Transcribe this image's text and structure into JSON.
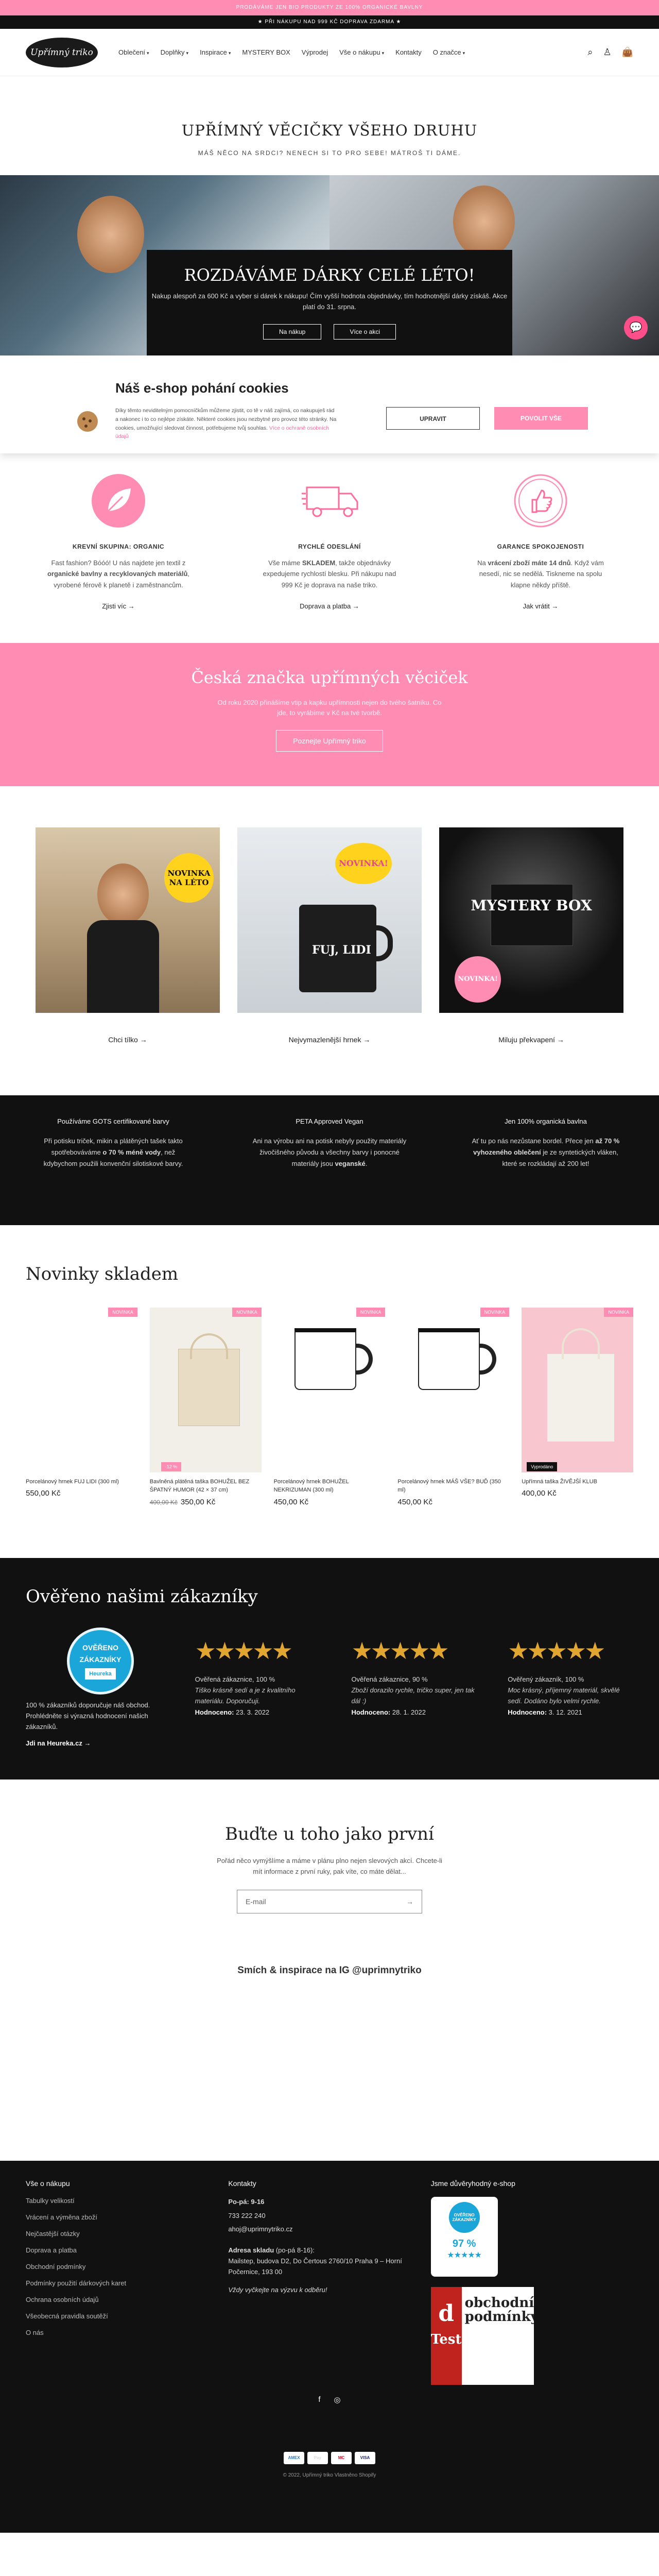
{
  "announcement": {
    "pink": "PRODÁVÁME JEN BIO PRODUKTY ZE 100% ORGANICKÉ BAVLNY",
    "black": "★ PŘI NÁKUPU NAD 999 KČ DOPRAVA ZDARMA ★"
  },
  "header": {
    "logo": "Upřímný triko",
    "nav": [
      "Oblečení",
      "Doplňky",
      "Inspirace",
      "MYSTERY BOX",
      "Výprodej",
      "Vše o nákupu",
      "Kontakty",
      "O značce"
    ],
    "nav_dropdown": [
      true,
      true,
      true,
      false,
      false,
      true,
      false,
      true
    ]
  },
  "hero": {
    "title": "UPŘÍMNÝ VĚCIČKY VŠEHO DRUHU",
    "subtitle": "MÁŠ NĚCO NA SRDCI? NENECH SI TO PRO SEBE! MÁTROŠ TI DÁME.",
    "banner_title": "ROZDÁVÁME DÁRKY CELÉ LÉTO!",
    "banner_text": "Nakup alespoň za 600 Kč a vyber si dárek k nákupu! Čím vyšší hodnota objednávky, tím hodnotnější dárky získáš. Akce platí do 31. srpna.",
    "btn1": "Na nákup",
    "btn2": "Více o akci"
  },
  "cookies": {
    "title": "Náš e-shop pohání cookies",
    "text": "Díky těmto neviditelným pomocníčkům můžeme zjistit, co tě v náš zajímá, co nakupuješ rád a nakonec i to co nejlépe získáte. Některé cookies jsou nezbytné pro provoz této stránky. Na cookies, umožňující sledovat činnost, potřebujeme tvůj souhlas.",
    "link": "Více o ochraně osobních údajů",
    "btn_adjust": "UPRAVIT",
    "btn_allow": "POVOLIT VŠE"
  },
  "features": [
    {
      "title": "KREVNÍ SKUPINA: ORGANIC",
      "text_a": "Fast fashion? Bóóó! U nás najdete jen textil z ",
      "bold": "organické bavlny a recyklovaných materiálů",
      "text_b": ", vyrobené férově k planetě i zaměstnancům.",
      "link": "Zjisti víc"
    },
    {
      "title": "RYCHLÉ ODESLÁNÍ",
      "text_a": "Vše máme ",
      "bold": "SKLADEM",
      "text_b": ", takže objednávky expedujeme rychlostí blesku. Při nákupu nad 999 Kč je doprava na naše triko.",
      "link": "Doprava a platba"
    },
    {
      "title": "GARANCE SPOKOJENOSTI",
      "text_a": "Na ",
      "bold": "vrácení zboží máte 14 dnů",
      "text_b": ". Když vám nesedí, nic se nedělá. Tiskneme na spolu klapne někdy příště.",
      "link": "Jak vrátit"
    }
  ],
  "pink_band": {
    "title": "Česká značka upřímných věciček",
    "text": "Od roku 2020 přinášíme vtip a kapku upřímnosti nejen do tvého šatníku. Co jde, to vyrábíme v Kč na tvé tvorbě.",
    "button": "Poznejte Upřímný triko"
  },
  "collections": [
    {
      "label": "Chci tílko",
      "badge": "NOVINKA NA LÉTO"
    },
    {
      "label": "Nejvymazlenější hrnek",
      "badge": "NOVINKA!"
    },
    {
      "label": "Miluju překvapení",
      "badge": "NOVINKA!",
      "mystery": "MYSTERY BOX"
    }
  ],
  "info_strip": [
    {
      "title": "Používáme GOTS certifikované barvy",
      "text_a": "Při potisku triček, mikin a plátěných tašek takto spotřebováváme ",
      "bold": "o 70 % méně vody",
      "text_b": ", než kdybychom použili konvenční silotiskové barvy."
    },
    {
      "title": "PETA Approved Vegan",
      "text_a": "Ani na výrobu ani na potisk nebyly použity materiály živočišného původu a všechny barvy i ponocné materiály jsou ",
      "bold": "veganské",
      "text_b": "."
    },
    {
      "title": "Jen 100% organická bavlna",
      "text_a": "Ať tu po nás nezůstane bordel. Přece jen ",
      "bold": "až 70 % vyhozeného oblečení",
      "text_b": " je ze syntetických vláken, které se rozkládají až 200 let!"
    }
  ],
  "new_products": {
    "title": "Novinky skladem",
    "items": [
      {
        "name": "Porcelánový hrnek FUJ LIDI (300 ml)",
        "price": "550,00 Kč",
        "sale": "NOVINKA",
        "old": ""
      },
      {
        "name": "Bavlněná plátěná taška BOHUŽEL BEZ ŠPATNÝ HUMOR (42 × 37 cm)",
        "price": "350,00 Kč",
        "sale": "NOVINKA",
        "old": "400,00 Kč",
        "discount": "-12 %"
      },
      {
        "name": "Porcelánový hrnek BOHUŽEL NEKRIZUMAN (300 ml)",
        "price": "450,00 Kč",
        "sale": "NOVINKA",
        "old": ""
      },
      {
        "name": "Porcelánový hrnek MÁŠ VŠE? BUĎ (350 ml)",
        "price": "450,00 Kč",
        "sale": "NOVINKA",
        "old": ""
      },
      {
        "name": "Upřímná taška ŽIVĚJŠÍ KLUB",
        "price": "400,00 Kč",
        "sale": "NOVINKA",
        "old": "",
        "soldout": "Vyprodáno"
      }
    ]
  },
  "reviews": {
    "title": "Ověřeno našimi zákazníky",
    "heureka_badge": "OVĚŘENO ZÁKAZNÍKY",
    "heureka_brand": "Heureka",
    "heureka_text": "100 % zákazníků doporučuje náš obchod. Prohlédněte si výrazná hodnocení našich zákazníků.",
    "heureka_link": "Jdi na Heureka.cz",
    "items": [
      {
        "head": "Ověřená zákaznice, 100 %",
        "quote": "Tiško krásně sedí a je z kvalitního materiálu. Doporučuji.",
        "date_label": "Hodnoceno:",
        "date": "23. 3. 2022"
      },
      {
        "head": "Ověřená zákaznice, 90 %",
        "quote": "Zboží dorazilo rychle, tričko super, jen tak dál :)",
        "date_label": "Hodnoceno:",
        "date": "28. 1. 2022"
      },
      {
        "head": "Ověřený zákazník, 100 %",
        "quote": "Moc krásný, příjemný materiál, skvělé sedí. Dodáno bylo velmi rychle.",
        "date_label": "Hodnoceno:",
        "date": "3. 12. 2021"
      }
    ]
  },
  "newsletter": {
    "title": "Buďte u toho jako první",
    "text": "Pořád něco vymýšlíme a máme v plánu plno nejen slevových akcí. Chcete-li mít informace z první ruky, pak víte, co máte dělat...",
    "placeholder": "E-mail"
  },
  "instagram": {
    "title": "Smích & inspirace na IG @uprimnytriko"
  },
  "footer": {
    "col1_title": "Vše o nákupu",
    "col1_links": [
      "Tabulky velikostí",
      "Vrácení a výměna zboží",
      "Nejčastější otázky",
      "Doprava a platba",
      "Obchodní podmínky",
      "Podmínky použití dárkových karet",
      "Ochrana osobních údajů",
      "Všeobecná pravidla soutěží",
      "O nás"
    ],
    "col2_title": "Kontakty",
    "hours": "Po-pá: 9-16",
    "phone": "733 222 240",
    "email": "ahoj@uprimnytriko.cz",
    "addr_label": "Adresa skladu",
    "addr_hours": " (po-pá 8-16):",
    "addr": "Mailstep, budova D2, Do Čertous 2760/10 Praha 9 – Horní Počernice, 193 00",
    "note": "Vždy vyčkejte na výzvu k odběru!",
    "col3_title": "Jsme důvěryhodný e-shop",
    "cert1_title": "OVĚŘENO ZÁKAZNÍKY",
    "cert1_pct": "97 %",
    "cert2_letter": "d",
    "cert2_text": "obchodní podmínky",
    "cert2_sub": "Test",
    "social": [
      "f",
      "◎"
    ],
    "payments": [
      "AMEX",
      "Pay",
      "MC",
      "VISA"
    ],
    "copyright": "© 2022, Upřímný triko Vlastněno Shopify"
  }
}
